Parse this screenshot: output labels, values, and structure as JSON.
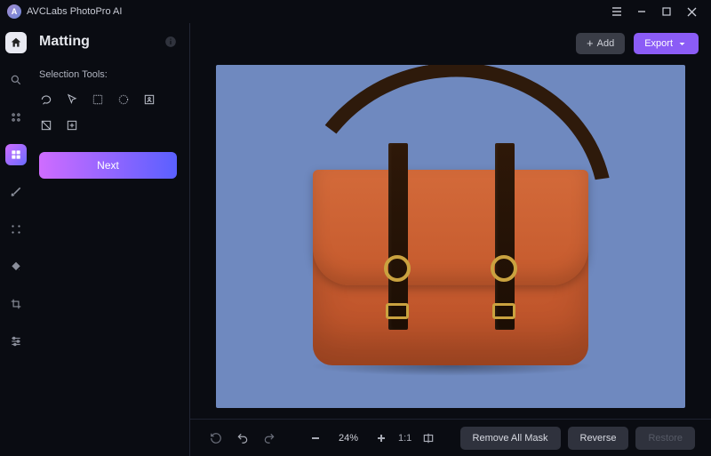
{
  "titlebar": {
    "app_name": "AVCLabs PhotoPro AI",
    "logo_letter": "A"
  },
  "sidepanel": {
    "heading": "Matting",
    "selection_label": "Selection Tools:",
    "next_button": "Next"
  },
  "topbar": {
    "add_label": "Add",
    "export_label": "Export"
  },
  "bottombar": {
    "zoom_percent": "24%",
    "fit_label": "1:1",
    "remove_mask": "Remove All Mask",
    "reverse": "Reverse",
    "restore": "Restore"
  }
}
